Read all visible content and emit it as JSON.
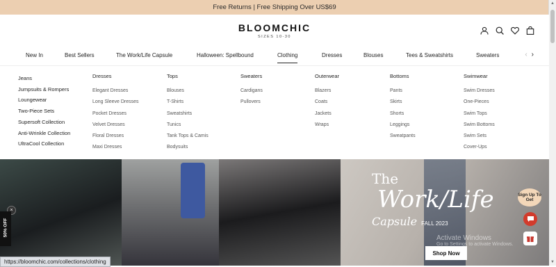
{
  "promo_bar": {
    "text": "Free Returns | Free Shipping Over US$69"
  },
  "brand": {
    "name": "BLOOMCHIC",
    "tagline": "SIZES 10-30"
  },
  "header_icons": [
    "account-icon",
    "search-icon",
    "wishlist-heart-icon",
    "shopping-bag-icon"
  ],
  "nav": {
    "items": [
      "New In",
      "Best Sellers",
      "The Work/Life Capsule",
      "Halloween: Spellbound",
      "Clothing",
      "Dresses",
      "Blouses",
      "Tees & Sweatshirts",
      "Sweaters"
    ],
    "active": "Clothing",
    "prev_arrow": "‹",
    "next_arrow": "›"
  },
  "mega_menu": {
    "quick_links": [
      "Jeans",
      "Jumpsuits & Rompers",
      "Loungewear",
      "Two-Piece Sets",
      "Supersoft Collection",
      "Anti-Wrinkle Collection",
      "UltraCool Collection"
    ],
    "columns": [
      {
        "heading": "Dresses",
        "links": [
          "Elegant Dresses",
          "Long Sleeve Dresses",
          "Pocket Dresses",
          "Velvet Dresses",
          "Floral Dresses",
          "Maxi Dresses"
        ]
      },
      {
        "heading": "Tops",
        "links": [
          "Blouses",
          "T-Shirts",
          "Sweatshirts",
          "Tunics",
          "Tank Tops & Camis",
          "Bodysuits"
        ]
      },
      {
        "heading": "Sweaters",
        "links": [
          "Cardigans",
          "Pullovers"
        ]
      },
      {
        "heading": "Outerwear",
        "links": [
          "Blazers",
          "Coats",
          "Jackets",
          "Wraps"
        ]
      },
      {
        "heading": "Bottoms",
        "links": [
          "Pants",
          "Skirts",
          "Shorts",
          "Leggings",
          "Sweatpants"
        ]
      },
      {
        "heading": "Swimwear",
        "links": [
          "Swim Dresses",
          "One-Pieces",
          "Swim Tops",
          "Swim Bottoms",
          "Swim Sets",
          "Cover-Ups"
        ]
      }
    ]
  },
  "hero": {
    "the": "The",
    "title": "Work/Life",
    "capsule": "Capsule",
    "season": "FALL 2023",
    "cta": "Shop Now"
  },
  "floating": {
    "signup": "Sign Up To Get",
    "discount_tab": "50% OFF",
    "close": "×"
  },
  "watermark": {
    "line1": "Activate Windows",
    "line2": "Go to Settings to activate Windows."
  },
  "status_bar": {
    "url": "https://bloomchic.com/collections/clothing"
  },
  "colors": {
    "promo_bg": "#eccfb1",
    "signup_bg": "#f3d7b9",
    "chat_red": "#d23b2c"
  }
}
